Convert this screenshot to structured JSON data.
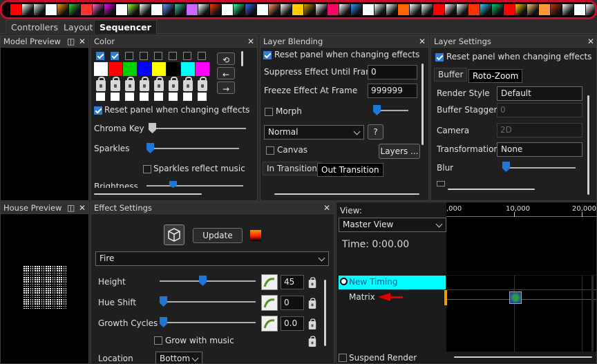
{
  "toolbar": {
    "icon_colors": [
      "#ff0000",
      "#ffffff",
      "#e6e6e6",
      "#ffffff",
      "#ff9900",
      "#33cc33",
      "#ff3333",
      "#ff66cc",
      "#ff00ff",
      "#ffffff",
      "#99ff33",
      "#ffffff",
      "#ffffff",
      "#6699ff",
      "#33cc99",
      "#cc66ff",
      "#ffffff",
      "#ff3300",
      "#ffffff",
      "#33ff99",
      "#3366ff",
      "#ffffff",
      "#ff9966",
      "#ffffff",
      "#ffcc00",
      "#cc9900",
      "#ffffff",
      "#ff0066",
      "#ffffff",
      "#3399ff",
      "#ffffff",
      "#ffffff",
      "#ffffff",
      "#ff6600",
      "#ffffff",
      "#ffffff",
      "#ff0000",
      "#ffffff",
      "#ffffff",
      "#ff3300",
      "#33ccff",
      "#00cc66",
      "#ff0000",
      "#ffcc00",
      "#ffcc66",
      "#ff9933",
      "#cc3300",
      "#ffffff",
      "#ffffff",
      "#ffffff",
      "#ff3333",
      "#00ff00",
      "#ffffff"
    ]
  },
  "tabs": [
    {
      "label": "Controllers",
      "active": false
    },
    {
      "label": "Layout",
      "active": false
    },
    {
      "label": "Sequencer",
      "active": true
    }
  ],
  "panels": {
    "model_preview": {
      "title": "Model Preview"
    },
    "house_preview": {
      "title": "House Preview"
    },
    "color": {
      "title": "Color",
      "palette": [
        "#ffffff",
        "#ff0000",
        "#00d000",
        "#0000ff",
        "#ffff00",
        "#000000",
        "#00ffff",
        "#ff00ff"
      ],
      "checked": [
        true,
        true,
        false,
        false,
        false,
        false,
        false,
        false
      ],
      "reset_label": "Reset panel when changing effects",
      "chroma_key": "Chroma Key",
      "sparkles": "Sparkles",
      "sparkles_reflect": "Sparkles reflect music",
      "brightness": "Brightness"
    },
    "layer_blending": {
      "title": "Layer Blending",
      "reset_label": "Reset panel when changing effects",
      "suppress_label": "Suppress Effect Until Frame",
      "suppress_value": "0",
      "freeze_label": "Freeze Effect At Frame",
      "freeze_value": "999999",
      "morph": "Morph",
      "blend_mode": "Normal",
      "help_button": "?",
      "canvas": "Canvas",
      "layers_button": "Layers ...",
      "in_transition": "In Transition",
      "out_transition": "Out Transition"
    },
    "layer_settings": {
      "title": "Layer Settings",
      "reset_label": "Reset panel when changing effects",
      "tab_buffer": "Buffer",
      "tab_rotozoom": "Roto-Zoom",
      "render_style_label": "Render Style",
      "render_style_value": "Default",
      "buffer_stagger_label": "Buffer Stagger",
      "buffer_stagger_value": "0",
      "camera_label": "Camera",
      "camera_value": "2D",
      "transformation_label": "Transformation",
      "transformation_value": "None",
      "blur_label": "Blur"
    },
    "effect_settings": {
      "title": "Effect Settings",
      "update_button": "Update",
      "effect_name": "Fire",
      "height_label": "Height",
      "height_value": "45",
      "hue_shift_label": "Hue Shift",
      "hue_shift_value": "0",
      "growth_cycles_label": "Growth Cycles",
      "growth_cycles_value": "0.0",
      "grow_with_music": "Grow with music",
      "location_label": "Location",
      "location_value": "Bottom"
    },
    "sequencer": {
      "view_label": "View:",
      "view_value": "Master View",
      "time_label": "Time: 0:00.00",
      "timing_row": "New Timing",
      "model_row": "Matrix",
      "suspend_render": "Suspend Render",
      "ruler_ticks": [
        ",000",
        "10,000",
        "20,000"
      ]
    }
  },
  "close_glyph": "✕",
  "dock_glyph": "◫"
}
